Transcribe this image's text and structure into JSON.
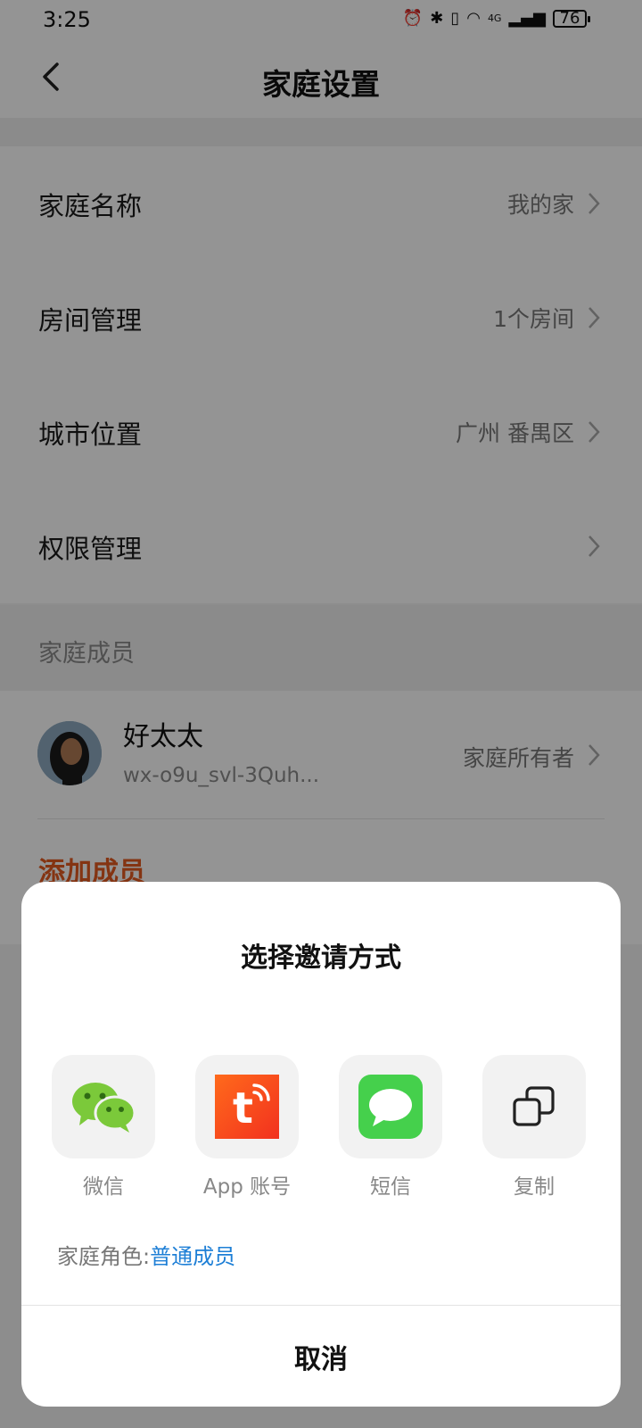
{
  "status": {
    "time": "3:25",
    "battery": "76",
    "network": "4G"
  },
  "nav": {
    "title": "家庭设置"
  },
  "settings": [
    {
      "label": "家庭名称",
      "value": "我的家"
    },
    {
      "label": "房间管理",
      "value": "1个房间"
    },
    {
      "label": "城市位置",
      "value": "广州 番禺区"
    },
    {
      "label": "权限管理",
      "value": ""
    }
  ],
  "members_section": {
    "title": "家庭成员"
  },
  "member": {
    "name": "好太太",
    "id": "wx-o9u_svl-3Quh...",
    "role": "家庭所有者"
  },
  "add_member": {
    "label": "添加成员"
  },
  "sheet": {
    "title": "选择邀请方式",
    "options": [
      {
        "label": "微信",
        "icon": "wechat-icon"
      },
      {
        "label": "App 账号",
        "icon": "tuya-app-icon"
      },
      {
        "label": "短信",
        "icon": "sms-icon"
      },
      {
        "label": "复制",
        "icon": "copy-icon"
      }
    ],
    "role_prefix": "家庭角色:",
    "role_value": "普通成员",
    "cancel": "取消"
  },
  "colors": {
    "accent_orange": "#e35a20",
    "link_blue": "#1e7fd6",
    "wechat_green": "#7bc93a",
    "sms_green": "#45d04c",
    "tuya_orange": "#ff4a1c"
  }
}
